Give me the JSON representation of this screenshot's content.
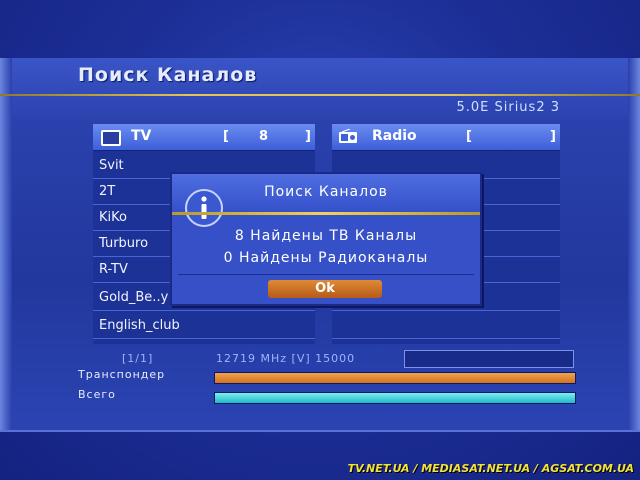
{
  "header": {
    "title": "Поиск Каналов",
    "satellite": "5.0E Sirius2 3"
  },
  "tv_panel": {
    "label": "TV",
    "bracket_open": "[",
    "count": "8",
    "bracket_close": "]",
    "channels": [
      "Svit",
      "2T",
      "KiKo",
      "Turburo",
      "R-TV",
      "Gold_Be..y",
      "English_club"
    ]
  },
  "radio_panel": {
    "label": "Radio",
    "bracket_open": "[",
    "bracket_close": "]"
  },
  "dialog": {
    "title": "Поиск Каналов",
    "line1": "8 Найдены ТВ Каналы",
    "line2": "0 Найдены Радиоканалы",
    "ok_label": "Ok"
  },
  "status": {
    "page": "[1/1]",
    "frequency": "12719 MHz [V] 15000",
    "transponder_label": "Транспондер",
    "total_label": "Всего"
  },
  "watermark": "TV.NET.UA / MEDIASAT.NET.UA / AGSAT.COM.UA",
  "colors": {
    "background": "#1a2a8c",
    "accent_gold": "#e2c55a",
    "ok_button": "#d2741e",
    "progress_orange": "#d2741e",
    "progress_cyan": "#22b8c6"
  }
}
